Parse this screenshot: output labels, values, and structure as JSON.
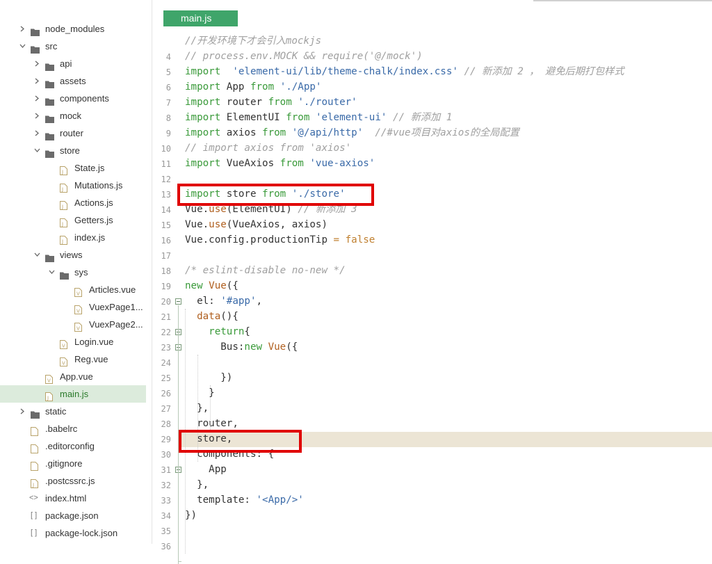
{
  "sidebar": {
    "items": [
      {
        "label": "node_modules",
        "type": "folder",
        "expanded": false,
        "depth": 0
      },
      {
        "label": "src",
        "type": "folder",
        "expanded": true,
        "depth": 0
      },
      {
        "label": "api",
        "type": "folder",
        "expanded": false,
        "depth": 1
      },
      {
        "label": "assets",
        "type": "folder",
        "expanded": false,
        "depth": 1
      },
      {
        "label": "components",
        "type": "folder",
        "expanded": false,
        "depth": 1
      },
      {
        "label": "mock",
        "type": "folder",
        "expanded": false,
        "depth": 1
      },
      {
        "label": "router",
        "type": "folder",
        "expanded": false,
        "depth": 1
      },
      {
        "label": "store",
        "type": "folder",
        "expanded": true,
        "depth": 1
      },
      {
        "label": "State.js",
        "type": "js",
        "depth": 2
      },
      {
        "label": "Mutations.js",
        "type": "js",
        "depth": 2
      },
      {
        "label": "Actions.js",
        "type": "js",
        "depth": 2
      },
      {
        "label": "Getters.js",
        "type": "js",
        "depth": 2
      },
      {
        "label": "index.js",
        "type": "js",
        "depth": 2
      },
      {
        "label": "views",
        "type": "folder",
        "expanded": true,
        "depth": 1
      },
      {
        "label": "sys",
        "type": "folder",
        "expanded": true,
        "depth": 2
      },
      {
        "label": "Articles.vue",
        "type": "vue",
        "depth": 3
      },
      {
        "label": "VuexPage1...",
        "type": "vue",
        "depth": 3
      },
      {
        "label": "VuexPage2...",
        "type": "vue",
        "depth": 3
      },
      {
        "label": "Login.vue",
        "type": "vue",
        "depth": 2
      },
      {
        "label": "Reg.vue",
        "type": "vue",
        "depth": 2
      },
      {
        "label": "App.vue",
        "type": "vue",
        "depth": 1
      },
      {
        "label": "main.js",
        "type": "js",
        "depth": 1,
        "selected": true
      },
      {
        "label": "static",
        "type": "folder",
        "expanded": false,
        "depth": 0
      },
      {
        "label": ".babelrc",
        "type": "file",
        "depth": 0
      },
      {
        "label": ".editorconfig",
        "type": "file",
        "depth": 0
      },
      {
        "label": ".gitignore",
        "type": "file",
        "depth": 0
      },
      {
        "label": ".postcssrc.js",
        "type": "js",
        "depth": 0
      },
      {
        "label": "index.html",
        "type": "html",
        "depth": 0
      },
      {
        "label": "package.json",
        "type": "json",
        "depth": 0
      },
      {
        "label": "package-lock.json",
        "type": "json",
        "depth": 0
      }
    ]
  },
  "editor": {
    "tab_label": "main.js",
    "current_line": 30,
    "lines": [
      {
        "n": "",
        "tokens": [
          [
            "cm",
            "//开发环境下才会引入mockjs"
          ]
        ]
      },
      {
        "n": "4",
        "tokens": [
          [
            "cm",
            "// process.env.MOCK && require('@/mock')"
          ]
        ]
      },
      {
        "n": "5",
        "tokens": [
          [
            "kw",
            "import"
          ],
          [
            "",
            "  "
          ],
          [
            "str",
            "'element-ui/lib/theme-chalk/index.css'"
          ],
          [
            "",
            ""
          ],
          [
            "cm",
            " // 新添加 2 ， 避免后期打包样式"
          ]
        ]
      },
      {
        "n": "6",
        "tokens": [
          [
            "kw",
            "import"
          ],
          [
            "",
            " App "
          ],
          [
            "kw",
            "from"
          ],
          [
            "",
            " "
          ],
          [
            "str",
            "'./App'"
          ]
        ]
      },
      {
        "n": "7",
        "tokens": [
          [
            "kw",
            "import"
          ],
          [
            "",
            " router "
          ],
          [
            "kw",
            "from"
          ],
          [
            "",
            " "
          ],
          [
            "str",
            "'./router'"
          ]
        ]
      },
      {
        "n": "8",
        "tokens": [
          [
            "kw",
            "import"
          ],
          [
            "",
            " ElementUI "
          ],
          [
            "kw",
            "from"
          ],
          [
            "",
            " "
          ],
          [
            "str",
            "'element-ui'"
          ],
          [
            "cm",
            " // 新添加 1"
          ]
        ]
      },
      {
        "n": "9",
        "tokens": [
          [
            "kw",
            "import"
          ],
          [
            "",
            " axios "
          ],
          [
            "kw",
            "from"
          ],
          [
            "",
            " "
          ],
          [
            "str",
            "'@/api/http'"
          ],
          [
            "cm",
            "  //#vue项目对axios的全局配置"
          ]
        ]
      },
      {
        "n": "10",
        "tokens": [
          [
            "cm",
            "// import axios from 'axios'"
          ]
        ]
      },
      {
        "n": "11",
        "tokens": [
          [
            "kw",
            "import"
          ],
          [
            "",
            " VueAxios "
          ],
          [
            "kw",
            "from"
          ],
          [
            "",
            " "
          ],
          [
            "str",
            "'vue-axios'"
          ]
        ]
      },
      {
        "n": "12",
        "tokens": []
      },
      {
        "n": "13",
        "tokens": [
          [
            "kw",
            "import"
          ],
          [
            "",
            " store "
          ],
          [
            "kw",
            "from"
          ],
          [
            "",
            " "
          ],
          [
            "str",
            "'./store'"
          ]
        ]
      },
      {
        "n": "14",
        "tokens": [
          [
            "",
            "Vue."
          ],
          [
            "fn",
            "use"
          ],
          [
            "",
            "(ElementUI)"
          ],
          [
            "cm",
            " // 新添加 3"
          ]
        ]
      },
      {
        "n": "15",
        "tokens": [
          [
            "",
            "Vue."
          ],
          [
            "fn",
            "use"
          ],
          [
            "",
            "(VueAxios, axios)"
          ]
        ]
      },
      {
        "n": "16",
        "tokens": [
          [
            "",
            "Vue.config.productionTip "
          ],
          [
            "op",
            "="
          ],
          [
            "",
            " "
          ],
          [
            "op",
            "false"
          ]
        ]
      },
      {
        "n": "17",
        "tokens": []
      },
      {
        "n": "18",
        "tokens": [
          [
            "cm",
            "/* eslint-disable no-new */"
          ]
        ]
      },
      {
        "n": "19",
        "tokens": [
          [
            "kw",
            "new"
          ],
          [
            "",
            " "
          ],
          [
            "fn",
            "Vue"
          ],
          [
            "",
            "({"
          ]
        ]
      },
      {
        "n": "20",
        "tokens": [
          [
            "",
            "  el: "
          ],
          [
            "str",
            "'#app'"
          ],
          [
            "",
            ","
          ]
        ]
      },
      {
        "n": "21",
        "tokens": [
          [
            "",
            "  "
          ],
          [
            "fn",
            "data"
          ],
          [
            "",
            "(){"
          ]
        ]
      },
      {
        "n": "22",
        "tokens": [
          [
            "",
            "    "
          ],
          [
            "kw",
            "return"
          ],
          [
            "",
            "{"
          ]
        ]
      },
      {
        "n": "23",
        "tokens": [
          [
            "",
            "      Bus:"
          ],
          [
            "kw",
            "new"
          ],
          [
            "",
            " "
          ],
          [
            "fn",
            "Vue"
          ],
          [
            "",
            "({"
          ]
        ]
      },
      {
        "n": "24",
        "tokens": []
      },
      {
        "n": "25",
        "tokens": [
          [
            "",
            "      })"
          ]
        ]
      },
      {
        "n": "26",
        "tokens": [
          [
            "",
            "    }"
          ]
        ]
      },
      {
        "n": "27",
        "tokens": [
          [
            "",
            "  },"
          ]
        ]
      },
      {
        "n": "28",
        "tokens": [
          [
            "",
            "  router,"
          ]
        ]
      },
      {
        "n": "29",
        "tokens": [
          [
            "",
            "  store,"
          ]
        ]
      },
      {
        "n": "30",
        "tokens": [
          [
            "",
            "  components: {"
          ]
        ]
      },
      {
        "n": "31",
        "tokens": [
          [
            "",
            "    App"
          ]
        ]
      },
      {
        "n": "32",
        "tokens": [
          [
            "",
            "  },"
          ]
        ]
      },
      {
        "n": "33",
        "tokens": [
          [
            "",
            "  template: "
          ],
          [
            "str",
            "'<App/>'"
          ]
        ]
      },
      {
        "n": "34",
        "tokens": [
          [
            "",
            "})"
          ]
        ]
      },
      {
        "n": "35",
        "tokens": []
      }
    ],
    "gutter_numbers": [
      "",
      "4",
      "5",
      "6",
      "7",
      "8",
      "9",
      "10",
      "11",
      "12",
      "13",
      "14",
      "15",
      "16",
      "17",
      "18",
      "19",
      "20",
      "21",
      "22",
      "23",
      "24",
      "25",
      "26",
      "27",
      "28",
      "29",
      "30",
      "31",
      "32",
      "33",
      "34",
      "35",
      "36"
    ]
  },
  "colors": {
    "accent": "#3fa56a",
    "highlight_box": "#e00000",
    "keyword": "#3a9a3a",
    "string": "#3a6aa8",
    "comment": "#a0a0a0"
  }
}
